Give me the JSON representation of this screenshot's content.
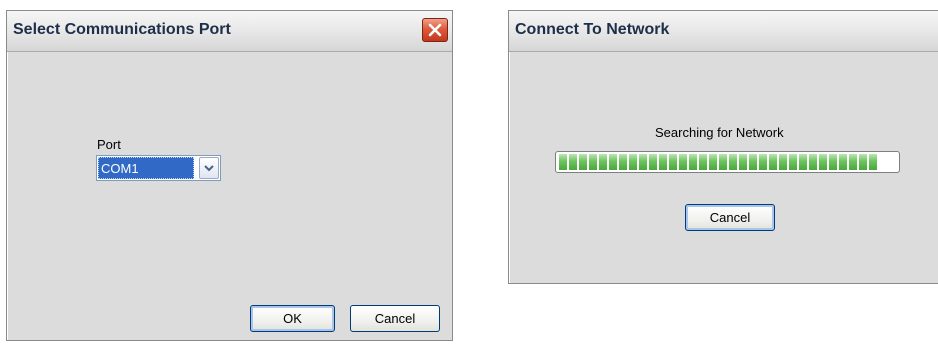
{
  "select_port_dialog": {
    "title": "Select Communications Port",
    "close_icon": "close-icon",
    "port_label": "Port",
    "port_select": {
      "value": "COM1",
      "arrow_icon": "chevron-down-icon"
    },
    "ok_label": "OK",
    "cancel_label": "Cancel"
  },
  "connect_dialog": {
    "title": "Connect To Network",
    "status_text": "Searching for Network",
    "progress": {
      "fraction": 0.95
    },
    "cancel_label": "Cancel"
  },
  "colors": {
    "window_bg": "#dcdcdc",
    "close_button": "#de5a3c",
    "selection": "#3169c6",
    "progress_fill": "#6bc45c"
  }
}
